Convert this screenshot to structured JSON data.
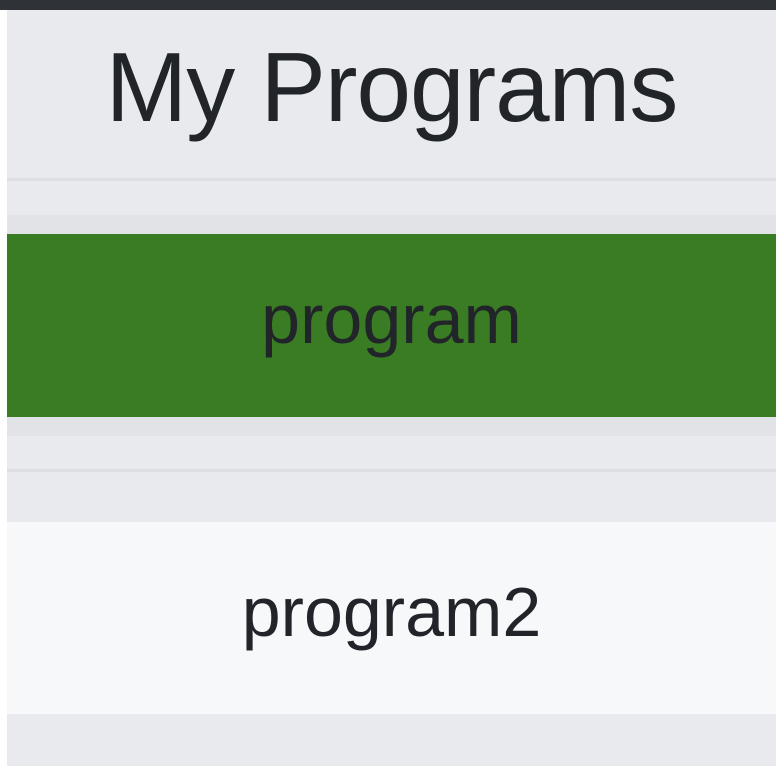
{
  "page": {
    "title": "My Programs"
  },
  "programs": [
    {
      "label": "program",
      "state": "selected"
    },
    {
      "label": "program2",
      "state": "default"
    }
  ],
  "colors": {
    "selected_background": "#3a7c24",
    "default_background": "#f7f8fa",
    "text": "#212529"
  }
}
